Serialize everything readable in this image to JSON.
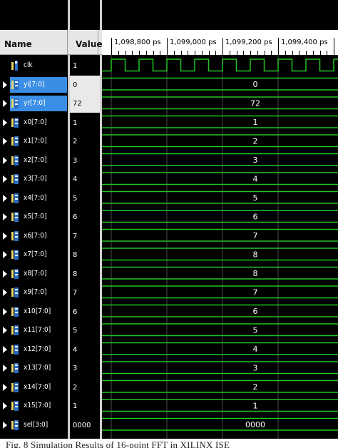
{
  "header": {
    "name_label": "Name",
    "value_label": "Value"
  },
  "timeline": {
    "ticks": [
      {
        "label": "1,098,800 ps"
      },
      {
        "label": "1,099,000 ps"
      },
      {
        "label": "1,099,200 ps"
      },
      {
        "label": "1,099,400 ps"
      }
    ]
  },
  "signals": [
    {
      "name": "clk",
      "value": "1",
      "bus": false,
      "selected": false,
      "wave": "clock"
    },
    {
      "name": "yi[7:0]",
      "value": "0",
      "bus": true,
      "selected": true,
      "wave": "0"
    },
    {
      "name": "yr[7:0]",
      "value": "72",
      "bus": true,
      "selected": true,
      "wave": "72"
    },
    {
      "name": "x0[7:0]",
      "value": "1",
      "bus": true,
      "selected": false,
      "wave": "1"
    },
    {
      "name": "x1[7:0]",
      "value": "2",
      "bus": true,
      "selected": false,
      "wave": "2"
    },
    {
      "name": "x2[7:0]",
      "value": "3",
      "bus": true,
      "selected": false,
      "wave": "3"
    },
    {
      "name": "x3[7:0]",
      "value": "4",
      "bus": true,
      "selected": false,
      "wave": "4"
    },
    {
      "name": "x4[7:0]",
      "value": "5",
      "bus": true,
      "selected": false,
      "wave": "5"
    },
    {
      "name": "x5[7:0]",
      "value": "6",
      "bus": true,
      "selected": false,
      "wave": "6"
    },
    {
      "name": "x6[7:0]",
      "value": "7",
      "bus": true,
      "selected": false,
      "wave": "7"
    },
    {
      "name": "x7[7:0]",
      "value": "8",
      "bus": true,
      "selected": false,
      "wave": "8"
    },
    {
      "name": "x8[7:0]",
      "value": "8",
      "bus": true,
      "selected": false,
      "wave": "8"
    },
    {
      "name": "x9[7:0]",
      "value": "7",
      "bus": true,
      "selected": false,
      "wave": "7"
    },
    {
      "name": "x10[7:0]",
      "value": "6",
      "bus": true,
      "selected": false,
      "wave": "6"
    },
    {
      "name": "x11[7:0]",
      "value": "5",
      "bus": true,
      "selected": false,
      "wave": "5"
    },
    {
      "name": "x12[7:0]",
      "value": "4",
      "bus": true,
      "selected": false,
      "wave": "4"
    },
    {
      "name": "x13[7:0]",
      "value": "3",
      "bus": true,
      "selected": false,
      "wave": "3"
    },
    {
      "name": "x14[7:0]",
      "value": "2",
      "bus": true,
      "selected": false,
      "wave": "2"
    },
    {
      "name": "x15[7:0]",
      "value": "1",
      "bus": true,
      "selected": false,
      "wave": "1"
    },
    {
      "name": "sel[3:0]",
      "value": "0000",
      "bus": true,
      "selected": false,
      "wave": "0000"
    }
  ],
  "caption": "Fig. 8 Simulation Results of 16-point FFT in XILINX ISE",
  "colors": {
    "wave": "#22c422",
    "selected": "#3b8ee6",
    "background": "#000000"
  },
  "icons": {
    "signal": "signal-icon",
    "expand": "expand-arrow-icon"
  }
}
